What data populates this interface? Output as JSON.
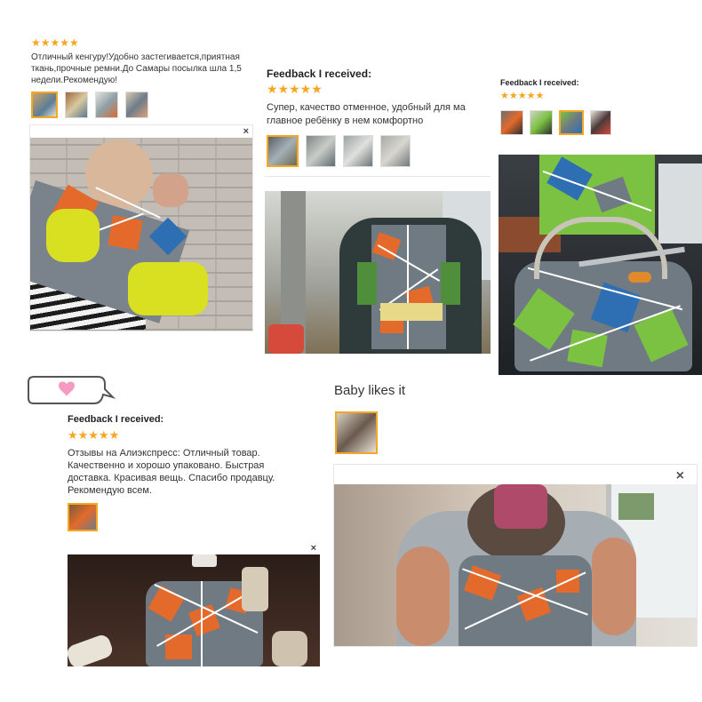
{
  "star_glyphs": "★★★★★",
  "close_glyph": "×",
  "colors": {
    "star": "#f5a623",
    "pattern_gray": "#6f7a83",
    "pattern_orange": "#e46a2b",
    "pattern_green": "#7cc242",
    "pattern_blue": "#2e6fb3",
    "strap_yellow": "#d9e021",
    "bubble_heart": "#f59ac0"
  },
  "review1": {
    "text": "Отличный кенгуру!Удобно застегивается,приятная ткань,прочные ремни.До Самары посылка шла 1,5 недели.Рекомендую!",
    "thumb_count": 4
  },
  "review2": {
    "heading": "Feedback I received:",
    "text": "Супер, качество отменное, удобный для ма главное ребёнку в нем комфортно",
    "thumb_count": 4
  },
  "review3": {
    "heading": "Feedback I received:",
    "thumb_count": 4
  },
  "review4": {
    "heading": "Feedback I received:",
    "text": "Отзывы на Алиэкспресс: Отличный товар. Качественно и хорошо упаковано. Быстрая доставка. Красивая вещь. Спасибо продавцу. Рекомендую всем.",
    "thumb_count": 1
  },
  "review5": {
    "heading": "Baby likes it",
    "thumb_count": 1
  }
}
